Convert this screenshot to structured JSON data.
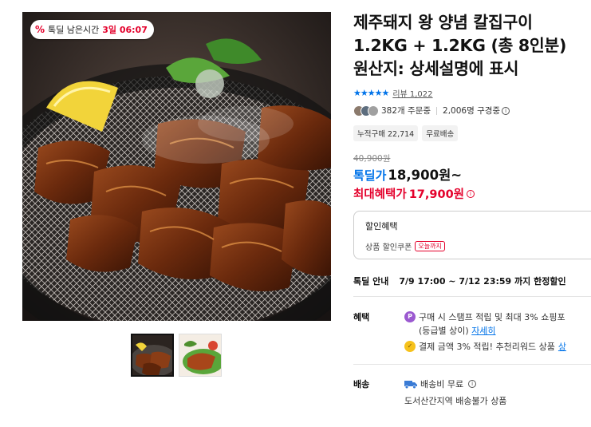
{
  "gallery": {
    "timer": {
      "icon": "percent-icon",
      "label": "톡딜 남은시간",
      "countdown": "3일 06:07"
    },
    "thumbnails": [
      {
        "name": "thumb-grilled-pork",
        "active": true
      },
      {
        "name": "thumb-lettuce-wrap",
        "active": false
      }
    ]
  },
  "product": {
    "title_line1": "제주돼지 왕 양념 칼집구이",
    "title_line2": "1.2KG + 1.2KG (총 8인분)",
    "title_line3": "원산지: 상세설명에 표시",
    "stars": "★★★★★",
    "review_text": "리뷰 1,022",
    "orders_text": "382개 주문중",
    "subscribers_text": "2,006명 구경중",
    "tags": [
      "누적구매 22,714",
      "무료배송"
    ]
  },
  "price": {
    "original": "40,900원",
    "deal_label": "톡딜가",
    "deal_price": "18,900원~",
    "max_label": "최대혜택가",
    "max_price": "17,900원"
  },
  "discount": {
    "title": "할인혜택",
    "coupon_label": "상품 할인쿠폰",
    "coupon_badge": "오늘까지"
  },
  "deal_guide": {
    "label": "톡딜 안내",
    "period": "7/9 17:00 ~ 7/12 23:59 까지 한정할인"
  },
  "benefit": {
    "label": "혜택",
    "coin1": "P",
    "line1": "구매 시 스탬프 적립 및 최대 3% 쇼핑포",
    "line1b_prefix": "(등급별 상이)",
    "line1b_link": "자세히",
    "coin2": "✓",
    "line2": "결제 금액 3% 적립! 추천리워드 상품",
    "line2_link": "상"
  },
  "shipping": {
    "label": "배송",
    "fee": "배송비 무료",
    "note": "도서산간지역 배송불가 상품"
  },
  "colors": {
    "accent_blue": "#0073e9",
    "accent_red": "#e4002b"
  }
}
